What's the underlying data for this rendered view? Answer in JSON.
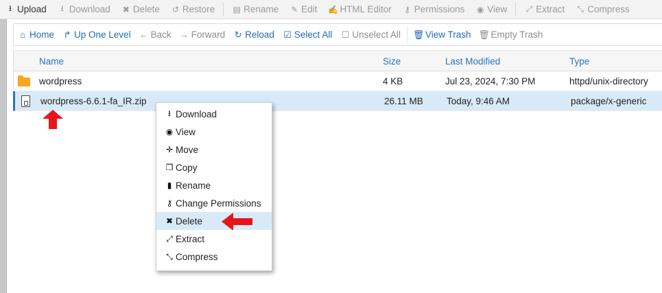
{
  "toolbar": {
    "items": [
      {
        "label": "Upload",
        "icon": "upload-icon"
      },
      {
        "label": "Download",
        "icon": "download-icon"
      },
      {
        "label": "Delete",
        "icon": "x-icon"
      },
      {
        "label": "Restore",
        "icon": "restore-icon"
      },
      {
        "label": "Rename",
        "icon": "file-icon"
      },
      {
        "label": "Edit",
        "icon": "pencil-icon"
      },
      {
        "label": "HTML Editor",
        "icon": "html-editor-icon"
      },
      {
        "label": "Permissions",
        "icon": "key-icon"
      },
      {
        "label": "View",
        "icon": "eye-icon"
      },
      {
        "label": "Extract",
        "icon": "expand-icon"
      },
      {
        "label": "Compress",
        "icon": "compress-icon"
      }
    ]
  },
  "navbar": {
    "items": [
      {
        "label": "Home",
        "icon": "home-icon"
      },
      {
        "label": "Up One Level",
        "icon": "level-up-icon"
      },
      {
        "label": "Back",
        "icon": "arrow-left-icon"
      },
      {
        "label": "Forward",
        "icon": "arrow-right-icon"
      },
      {
        "label": "Reload",
        "icon": "reload-icon"
      },
      {
        "label": "Select All",
        "icon": "checkbox-checked-icon"
      },
      {
        "label": "Unselect All",
        "icon": "checkbox-empty-icon"
      },
      {
        "label": "View Trash",
        "icon": "trash-icon"
      },
      {
        "label": "Empty Trash",
        "icon": "trash-icon"
      }
    ]
  },
  "table": {
    "headers": {
      "name": "Name",
      "size": "Size",
      "modified": "Last Modified",
      "type": "Type"
    },
    "rows": [
      {
        "icon": "folder-icon",
        "name": "wordpress",
        "size": "4 KB",
        "modified": "Jul 23, 2024, 7:30 PM",
        "type": "httpd/unix-directory"
      },
      {
        "icon": "zip-file-icon",
        "name": "wordpress-6.6.1-fa_IR.zip",
        "size": "26.11 MB",
        "modified": "Today, 9:46 AM",
        "type": "package/x-generic"
      }
    ]
  },
  "context_menu": {
    "items": [
      {
        "label": "Download",
        "icon": "download-icon"
      },
      {
        "label": "View",
        "icon": "eye-icon"
      },
      {
        "label": "Move",
        "icon": "move-icon"
      },
      {
        "label": "Copy",
        "icon": "copy-icon"
      },
      {
        "label": "Rename",
        "icon": "file-icon"
      },
      {
        "label": "Change Permissions",
        "icon": "key-icon"
      },
      {
        "label": "Delete",
        "icon": "x-icon"
      },
      {
        "label": "Extract",
        "icon": "expand-icon"
      },
      {
        "label": "Compress",
        "icon": "compress-icon"
      }
    ],
    "highlighted_item": "Delete"
  },
  "colors": {
    "accent": "#1f6bb8",
    "selection": "#d8eaf7",
    "annotation": "#e8141c",
    "folder": "#f5a623"
  }
}
